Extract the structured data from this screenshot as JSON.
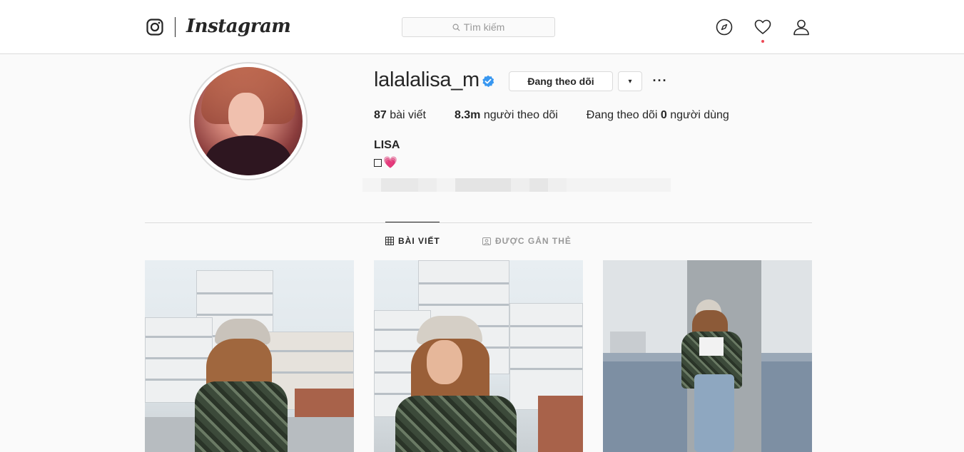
{
  "nav": {
    "wordmark": "Instagram",
    "search_placeholder": "Tìm kiếm"
  },
  "profile": {
    "username": "lalalalisa_m",
    "follow_button_label": "Đang theo dõi",
    "dropdown_label": "▾",
    "more_label": "···",
    "stats": {
      "posts_count": "87",
      "posts_label": " bài viết",
      "followers_count": "8.3m",
      "followers_label": " người theo dõi",
      "following_prefix": "Đang theo dõi ",
      "following_count": "0",
      "following_label": " người dùng"
    },
    "full_name": "LISA",
    "bio_heart": "💗"
  },
  "tabs": {
    "posts_label": "BÀI VIẾT",
    "tagged_label": "ĐƯỢC GẮN THẺ"
  },
  "colors": {
    "verified_badge": "#3897f0",
    "notification_dot": "#ed4956",
    "border": "#dbdbdb"
  },
  "icons": {
    "logo": "instagram-camera-icon",
    "explore": "compass-icon",
    "activity": "heart-icon",
    "profile": "person-icon",
    "search": "search-icon",
    "posts_tab": "grid-icon",
    "tagged_tab": "tagged-user-icon"
  }
}
